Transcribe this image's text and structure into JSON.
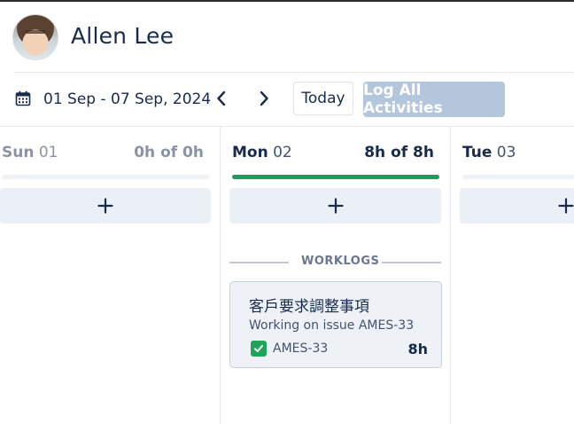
{
  "user": {
    "name": "Allen Lee"
  },
  "toolbar": {
    "date_range": "01 Sep - 07 Sep, 2024",
    "today_label": "Today",
    "log_all_label": "Log All Activities"
  },
  "days": [
    {
      "dow": "Sun",
      "num": "01",
      "hours": "0h of 0h",
      "progress": 0
    },
    {
      "dow": "Mon",
      "num": "02",
      "hours": "8h of 8h",
      "progress": 1
    },
    {
      "dow": "Tue",
      "num": "03"
    }
  ],
  "worklogs_label": "WORKLOGS",
  "worklog": {
    "title": "客戶要求調整事項",
    "description": "Working on issue AMES-33",
    "issue_key": "AMES-33",
    "hours": "8h"
  },
  "colors": {
    "accent_green": "#1f9a5b",
    "log_all_disabled": "#b3c6dc"
  }
}
